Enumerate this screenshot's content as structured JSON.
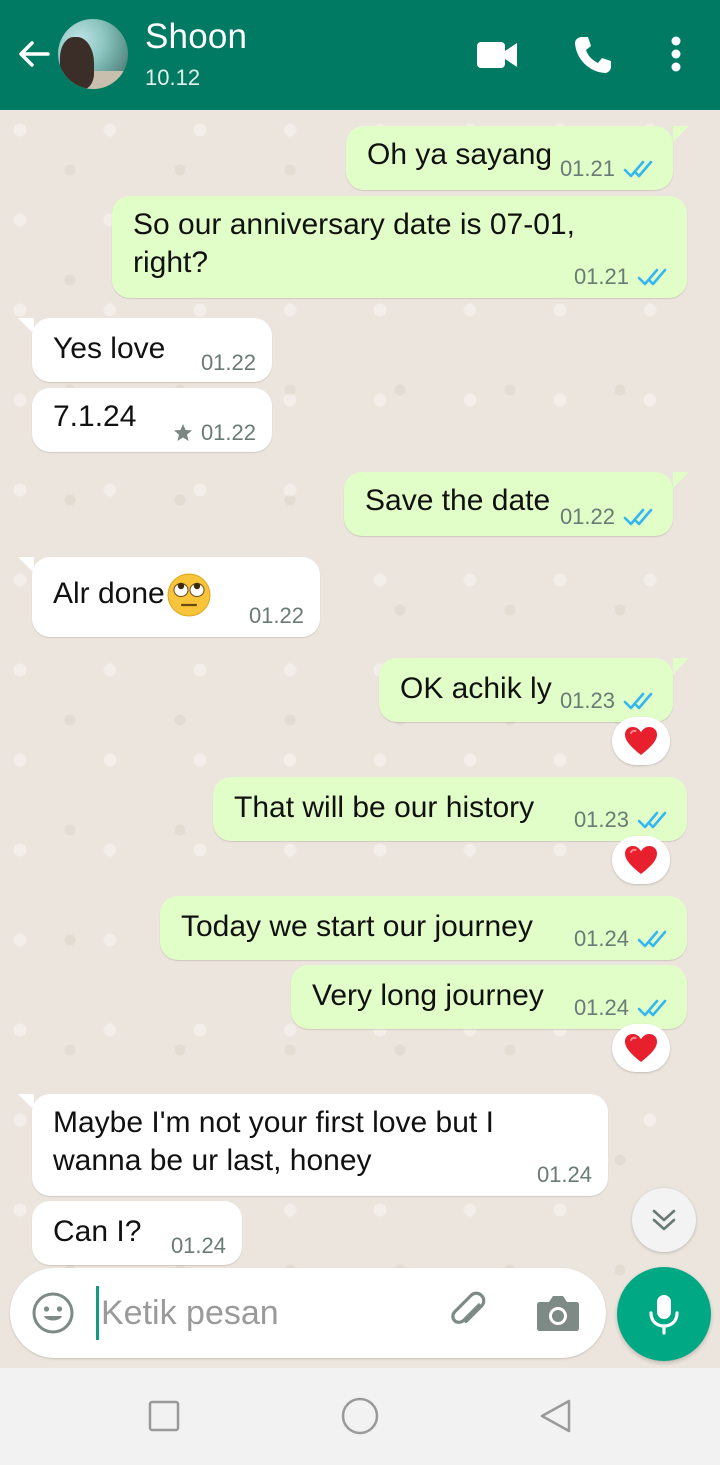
{
  "header": {
    "contact_name": "Shoon",
    "contact_status": "10.12",
    "bg_color": "#007a63"
  },
  "messages": [
    {
      "side": "out",
      "text": "Oh ya sayang",
      "time": "01.21",
      "status": "read"
    },
    {
      "side": "out",
      "text": "So our anniversary date is 07-01, right?",
      "time": "01.21",
      "status": "read"
    },
    {
      "side": "in",
      "text": "Yes love",
      "time": "01.22"
    },
    {
      "side": "in",
      "text": "7.1.24",
      "time": "01.22",
      "starred": true
    },
    {
      "side": "out",
      "text": "Save the date",
      "time": "01.22",
      "status": "read"
    },
    {
      "side": "in",
      "text": "Alr done",
      "emoji": "face-with-rolling-eyes",
      "time": "01.22"
    },
    {
      "side": "out",
      "text": "OK achik ly",
      "time": "01.23",
      "status": "read",
      "reaction": "❤️"
    },
    {
      "side": "out",
      "text": "That will be our history",
      "time": "01.23",
      "status": "read",
      "reaction": "❤️"
    },
    {
      "side": "out",
      "text": "Today we start our journey",
      "time": "01.24",
      "status": "read"
    },
    {
      "side": "out",
      "text": "Very long journey",
      "time": "01.24",
      "status": "read",
      "reaction": "❤️"
    },
    {
      "side": "in",
      "text": "Maybe I'm not your first love but I wanna be ur last, honey",
      "time": "01.24"
    },
    {
      "side": "in",
      "text": "Can I?",
      "time": "01.24"
    }
  ],
  "input": {
    "placeholder": "Ketik pesan",
    "value": ""
  },
  "colors": {
    "outgoing_bubble": "#e2fec8",
    "incoming_bubble": "#ffffff",
    "read_ticks": "#34b7f1",
    "mic_button": "#00a884"
  },
  "icons": [
    "back-arrow-icon",
    "video-call-icon",
    "phone-icon",
    "more-vert-icon",
    "double-check-icon",
    "star-icon",
    "heart-icon",
    "chevrons-down-icon",
    "emoji-icon",
    "paperclip-icon",
    "camera-icon",
    "mic-icon",
    "square-nav-icon",
    "circle-nav-icon",
    "triangle-nav-icon"
  ]
}
